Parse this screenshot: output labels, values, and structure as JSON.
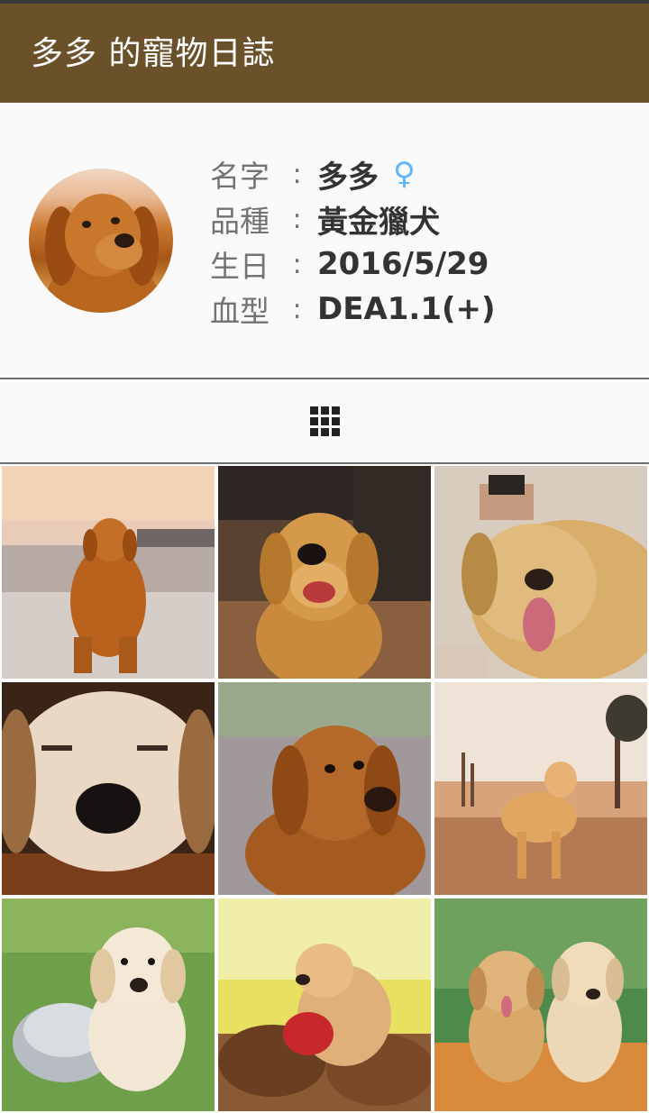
{
  "app_bar": {
    "title": "多多 的寵物日誌"
  },
  "profile": {
    "avatar": "dog-avatar",
    "fields": [
      {
        "label": "名字",
        "colon": ":",
        "value": "多多"
      },
      {
        "label": "品種",
        "colon": ":",
        "value": "黃金獵犬"
      },
      {
        "label": "生日",
        "colon": ":",
        "value": "2016/5/29"
      },
      {
        "label": "血型",
        "colon": ":",
        "value": "DEA1.1(+)"
      }
    ],
    "gender_symbol": "♀",
    "gender_color": "#64b5f6"
  },
  "tabs": {
    "active": "grid-view-icon"
  },
  "photos": [
    {
      "scene": "dog-on-beach-sunset"
    },
    {
      "scene": "dog-smiling-cafe"
    },
    {
      "scene": "dog-lying-petted"
    },
    {
      "scene": "dog-closeup-nose"
    },
    {
      "scene": "dog-head-tilt"
    },
    {
      "scene": "dog-standing-field"
    },
    {
      "scene": "puppy-in-bowl"
    },
    {
      "scene": "puppy-with-red-ball"
    },
    {
      "scene": "two-puppies-flowers"
    }
  ],
  "colors": {
    "app_bar": "#6b512a",
    "background": "#fafafa",
    "divider": "#6e6e6e"
  }
}
